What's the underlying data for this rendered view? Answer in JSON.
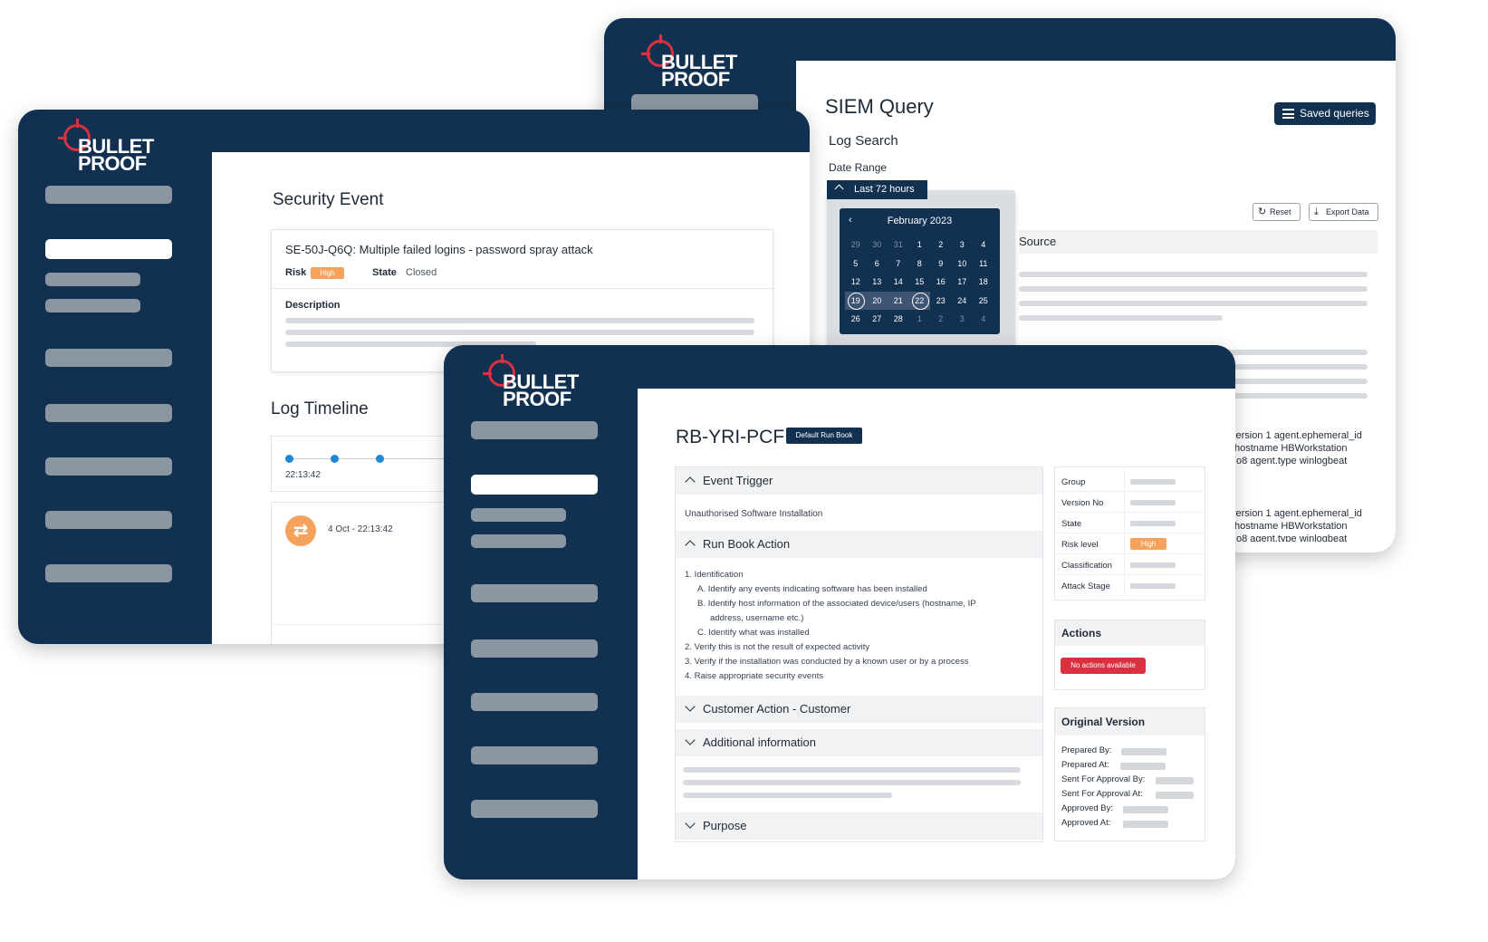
{
  "brand": {
    "line1": "BULLET",
    "line2": "PROOF"
  },
  "colors": {
    "navy": "#12304f",
    "accent_red": "#d9313f",
    "high_orange": "#f5a25c",
    "timeline_blue": "#1e88d6"
  },
  "siem": {
    "title": "SIEM Query",
    "subtitle": "Log Search",
    "date_range_label": "Date Range",
    "range_button": "Last 72 hours",
    "saved_queries": "Saved queries",
    "reset": "Reset",
    "export": "Export Data",
    "source_header": "Source",
    "calendar": {
      "month": "February 2023",
      "prev": "‹",
      "days": [
        "29",
        "30",
        "31",
        "1",
        "2",
        "3",
        "4",
        "5",
        "6",
        "7",
        "8",
        "9",
        "10",
        "11",
        "12",
        "13",
        "14",
        "15",
        "16",
        "17",
        "18",
        "19",
        "20",
        "21",
        "22",
        "23",
        "24",
        "25",
        "26",
        "27",
        "28",
        "1",
        "2",
        "3",
        "4"
      ]
    },
    "log_lines": [
      "version 1 agent.ephemeral_id",
      "hostname HBWorkstation",
      "o8 agent.type winlogbeat",
      "version 1 agent.ephemeral_id",
      "hostname HBWorkstation",
      "o8 agent.type winlogbeat"
    ]
  },
  "security": {
    "title": "Security Event",
    "event_title": "SE-50J-Q6Q: Multiple failed logins - password spray attack",
    "risk_label": "Risk",
    "risk_value": "High",
    "state_label": "State",
    "state_value": "Closed",
    "description_label": "Description",
    "timeline_title": "Log Timeline",
    "timeline_time": "22:13:42",
    "event_time": "4 Oct - 22:13:42"
  },
  "runbook": {
    "title": "RB-YRI-PCF",
    "badge": "Default Run Book",
    "sections": {
      "event_trigger": "Event Trigger",
      "event_trigger_text": "Unauthorised Software Installation",
      "run_book_action": "Run Book Action",
      "customer_action": "Customer Action - Customer",
      "additional_info": "Additional information",
      "purpose": "Purpose"
    },
    "steps": [
      "1.   Identification",
      "A.   Identify any events indicating software has been installed",
      "B.   Identify host information of the associated device/users (hostname, IP",
      "address, username etc.)",
      "C.   Identify what was installed",
      "2.   Verify this is not the result of expected activity",
      "3.   Verify if the installation was conducted by a known user or by a process",
      "4.   Raise appropriate security events"
    ],
    "properties": {
      "group": "Group",
      "version": "Version No",
      "state": "State",
      "risk": "Risk level",
      "risk_value": "High",
      "classification": "Classification",
      "attack_stage": "Attack Stage"
    },
    "actions_title": "Actions",
    "no_actions": "No actions available",
    "original_version_title": "Original Version",
    "original": {
      "prepared_by": "Prepared By:",
      "prepared_at": "Prepared At:",
      "sent_by": "Sent For Approval By:",
      "sent_at": "Sent For Approval At:",
      "approved_by": "Approved By:",
      "approved_at": "Approved At:"
    }
  }
}
